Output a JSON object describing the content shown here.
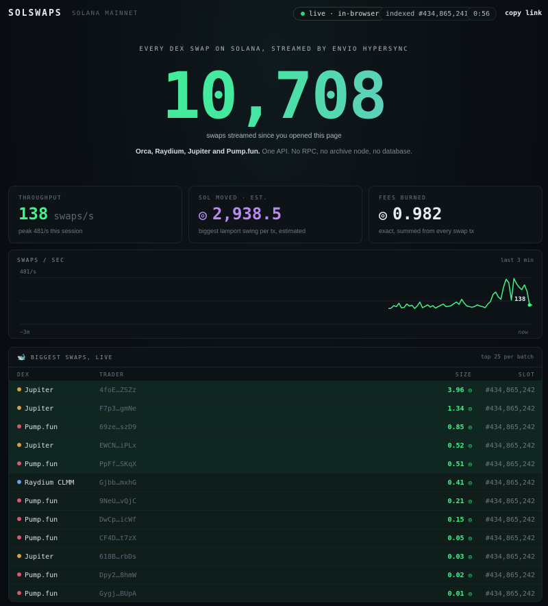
{
  "header": {
    "brand": "SOLSWAPS",
    "network": "SOLANA MAINNET",
    "live_label": "live · in-browser",
    "indexed_label": "indexed #434,865,241",
    "timer": "0:56",
    "copy_link": "copy link"
  },
  "hero": {
    "tagline": "EVERY DEX SWAP ON SOLANA, STREAMED BY ENVIO HYPERSYNC",
    "count": "10,708",
    "subtitle": "swaps streamed since you opened this page",
    "desc_bold": "Orca, Raydium, Jupiter and Pump.fun.",
    "desc_rest": " One API. No RPC, no archive node, no database."
  },
  "stats": {
    "throughput": {
      "label": "THROUGHPUT",
      "value": "138",
      "unit": "swaps/s",
      "note": "peak 481/s this session"
    },
    "sol_moved": {
      "label": "SOL MOVED · EST.",
      "value": "2,938.5",
      "note": "biggest lamport swing per tx, estimated"
    },
    "fees": {
      "label": "FEES BURNED",
      "value": "0.982",
      "note": "exact, summed from every swap tx"
    }
  },
  "colors": {
    "accent_green": "#3ff58a",
    "accent_purple": "#b98af0",
    "jupiter": "#d9a23a",
    "pumpfun": "#e0566f",
    "raydium": "#6aa3e8"
  },
  "chart": {
    "title": "SWAPS / SEC",
    "range_label": "last 3 min",
    "peak_label": "481/s",
    "x_start_label": "−3m",
    "x_end_label": "now",
    "current_label": "138"
  },
  "chart_data": {
    "type": "line",
    "title": "SWAPS / SEC",
    "xlabel": "",
    "ylabel": "",
    "ylim": [
      0,
      481
    ],
    "xlim_labels": [
      "−3m",
      "now"
    ],
    "grid": true,
    "series": [
      {
        "values": [
          0,
          0,
          0,
          0,
          0,
          0,
          0,
          0,
          0,
          0,
          0,
          0,
          0,
          0,
          0,
          0,
          0,
          0,
          0,
          0,
          0,
          0,
          0,
          0,
          0,
          0,
          0,
          0,
          0,
          0,
          0,
          0,
          0,
          0,
          0,
          0,
          0,
          0,
          0,
          0,
          0,
          0,
          0,
          0,
          0,
          0,
          0,
          0,
          0,
          0,
          0,
          0,
          0,
          0,
          0,
          0,
          0,
          0,
          0,
          0,
          0,
          0,
          0,
          0,
          0,
          0,
          0,
          0,
          0,
          0,
          0,
          0,
          0,
          0,
          0,
          0,
          0,
          0,
          0,
          0,
          0,
          0,
          0,
          0,
          0,
          0,
          0,
          0,
          0,
          0,
          0,
          0,
          0,
          0,
          0,
          0,
          0,
          0,
          0,
          0,
          0,
          0,
          0,
          0,
          0,
          0,
          0,
          0,
          0,
          0,
          0,
          0,
          0,
          0,
          0,
          0,
          0,
          0,
          0,
          0,
          0,
          0,
          0,
          0,
          0,
          0,
          0,
          0,
          0,
          0,
          0,
          0,
          0,
          0,
          0,
          0,
          0,
          0,
          0,
          0,
          0,
          95,
          98,
          130,
          118,
          160,
          102,
          108,
          150,
          125,
          135,
          95,
          125,
          175,
          105,
          120,
          140,
          112,
          130,
          100,
          118,
          135,
          150,
          118,
          122,
          130,
          155,
          175,
          145,
          210,
          160,
          125,
          118,
          110,
          120,
          140,
          125,
          118,
          105,
          150,
          180,
          270,
          300,
          240,
          210,
          360,
          460,
          420,
          200,
          470,
          405,
          360,
          330,
          390,
          310,
          138,
          138
        ]
      }
    ]
  },
  "table": {
    "title": "BIGGEST SWAPS, LIVE",
    "meta": "top 25 per batch",
    "headers": {
      "dex": "DEX",
      "trader": "TRADER",
      "size": "SIZE",
      "slot": "SLOT"
    },
    "sol_symbol": "◎",
    "rows": [
      {
        "dex": "Jupiter",
        "kind": "jupiter",
        "trader": "4foE…ZSZz",
        "size": "3.96",
        "slot": "#434,865,242"
      },
      {
        "dex": "Jupiter",
        "kind": "jupiter",
        "trader": "F7p3…gmNe",
        "size": "1.34",
        "slot": "#434,865,242"
      },
      {
        "dex": "Pump.fun",
        "kind": "pumpfun",
        "trader": "69ze…szD9",
        "size": "0.85",
        "slot": "#434,865,242"
      },
      {
        "dex": "Jupiter",
        "kind": "jupiter",
        "trader": "EWCN…iPLx",
        "size": "0.52",
        "slot": "#434,865,242"
      },
      {
        "dex": "Pump.fun",
        "kind": "pumpfun",
        "trader": "PpFf…SKqX",
        "size": "0.51",
        "slot": "#434,865,242"
      },
      {
        "dex": "Raydium CLMM",
        "kind": "raydium",
        "trader": "Gjbb…mxhG",
        "size": "0.41",
        "slot": "#434,865,242"
      },
      {
        "dex": "Pump.fun",
        "kind": "pumpfun",
        "trader": "9NeU…vQjC",
        "size": "0.21",
        "slot": "#434,865,242"
      },
      {
        "dex": "Pump.fun",
        "kind": "pumpfun",
        "trader": "DwCp…icWf",
        "size": "0.15",
        "slot": "#434,865,242"
      },
      {
        "dex": "Pump.fun",
        "kind": "pumpfun",
        "trader": "CF4D…t7zX",
        "size": "0.05",
        "slot": "#434,865,242"
      },
      {
        "dex": "Jupiter",
        "kind": "jupiter",
        "trader": "618B…rbDs",
        "size": "0.03",
        "slot": "#434,865,242"
      },
      {
        "dex": "Pump.fun",
        "kind": "pumpfun",
        "trader": "Dpy2…8hmW",
        "size": "0.02",
        "slot": "#434,865,242"
      },
      {
        "dex": "Pump.fun",
        "kind": "pumpfun",
        "trader": "Gygj…BUpA",
        "size": "0.01",
        "slot": "#434,865,242"
      }
    ]
  }
}
